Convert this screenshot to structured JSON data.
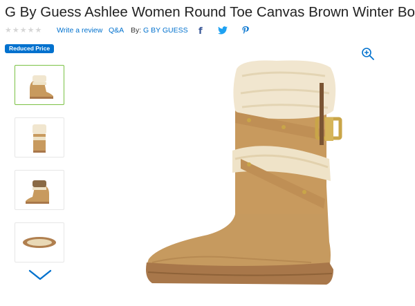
{
  "product": {
    "title": "G By Guess Ashlee Women Round Toe Canvas Brown Winter Boot",
    "rating_stars": "★★★★★",
    "write_review": "Write a review",
    "qa": "Q&A",
    "by_label": "By:",
    "brand": "G BY GUESS",
    "badge": "Reduced Price"
  },
  "share": [
    {
      "name": "facebook-icon",
      "glyph": "f",
      "color": "#3b5998"
    },
    {
      "name": "twitter-icon",
      "glyph": "bird",
      "color": "#1da1f2"
    },
    {
      "name": "pinterest-icon",
      "glyph": "P",
      "color": "#0071ce"
    }
  ],
  "thumbnails": [
    {
      "view": "side",
      "selected": true
    },
    {
      "view": "front",
      "selected": false
    },
    {
      "view": "side-reverse",
      "selected": false
    },
    {
      "view": "sole",
      "selected": false
    }
  ],
  "colors": {
    "accent": "#0071ce",
    "selected_border": "#7ac143",
    "boot": "#c89a5e",
    "fur": "#f1e6cf",
    "sole": "#a8774a",
    "buckle": "#c9a548"
  }
}
